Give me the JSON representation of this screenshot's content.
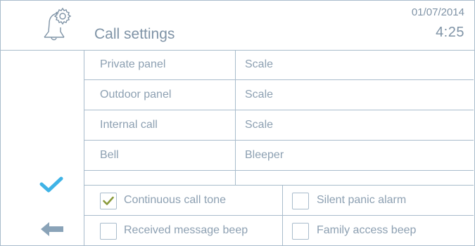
{
  "header": {
    "title": "Call settings",
    "date": "01/07/2014",
    "time": "4:25",
    "icon": "bell-settings-icon"
  },
  "settings": {
    "rows": [
      {
        "label": "Private panel",
        "value": "Scale"
      },
      {
        "label": "Outdoor panel",
        "value": "Scale"
      },
      {
        "label": "Internal call",
        "value": "Scale"
      },
      {
        "label": "Bell",
        "value": "Bleeper"
      },
      {
        "label": "",
        "value": ""
      }
    ]
  },
  "options": [
    {
      "label": "Continuous call tone",
      "checked": true
    },
    {
      "label": "Silent panic alarm",
      "checked": false
    },
    {
      "label": "Received message beep",
      "checked": false
    },
    {
      "label": "Family access beep",
      "checked": false
    }
  ],
  "nav": {
    "confirm_icon": "checkmark-icon",
    "back_icon": "back-arrow-icon"
  },
  "colors": {
    "text": "#8da0b2",
    "border": "#a9bccc",
    "confirm": "#3fb3e6",
    "back": "#8aa3b8",
    "check": "#8a9a3c"
  }
}
